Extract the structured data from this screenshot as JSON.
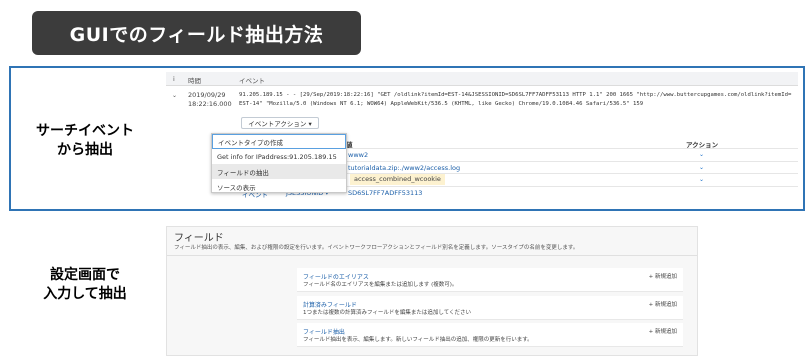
{
  "title": "GUIでのフィールド抽出方法",
  "side_labels": {
    "search": "サーチイベント\nから抽出",
    "settings": "設定画面で\n入力して抽出"
  },
  "search_panel": {
    "header": {
      "info": "i",
      "time": "時間",
      "event": "イベント"
    },
    "event": {
      "date": "2019/09/29",
      "time": "18:22:16.000",
      "line1": "91.205.189.15 - - [29/Sep/2019:18:22:16] \"GET /oldlink?itemId=EST-14&JSESSIONID=SD6SL7FF7ADFF53113 HTTP 1.1\" 200 1665 \"http://www.buttercupgames.com/oldlink?itemId=",
      "line2": "EST-14\" \"Mozilla/5.0 (Windows NT 6.1; WOW64) AppleWebKit/536.5 (KHTML, like Gecko) Chrome/19.0.1084.46 Safari/536.5\" 159"
    },
    "event_actions_button": "イベントアクション ▾",
    "dropdown": [
      "イベントタイプの作成",
      "Get info for IPaddress:91.205.189.15",
      "フィールドの抽出",
      "ソースの表示"
    ],
    "table": {
      "value_header": "値",
      "action_header": "アクション",
      "rows": [
        "www2",
        "tutorialdata.zip:./www2/access.log",
        "access_combined_wcookie",
        "SD6SL7FF7ADFF53113"
      ],
      "last_row_left": "イベント",
      "last_row_field": "JSESSIONID ▾"
    }
  },
  "settings_panel": {
    "title": "フィールド",
    "description": "フィールド抽出の表示、編集、および権限の設定を行います。イベントワークフローアクションとフィールド別名を定義します。ソースタイプの名前を変更します。",
    "cards": [
      {
        "title": "フィールドのエイリアス",
        "desc": "フィールド名のエイリアスを編集または追加します (複数可)。",
        "action": "+ 新規追加"
      },
      {
        "title": "計算済みフィールド",
        "desc": "1つまたは複数の計算済みフィールドを編集または追加してください",
        "action": "+ 新規追加"
      },
      {
        "title": "フィールド抽出",
        "desc": "フィールド抽出を表示、編集します。新しいフィールド抽出の追加、権限の更新を行います。",
        "action": "+ 新規追加"
      }
    ]
  }
}
